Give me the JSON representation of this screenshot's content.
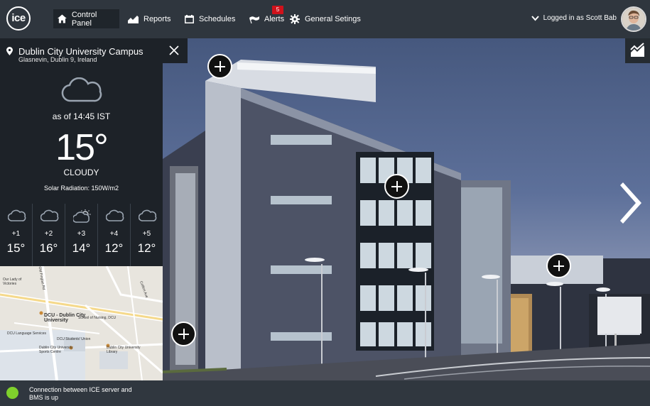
{
  "app": {
    "logo_text": "ice"
  },
  "nav": {
    "items": [
      {
        "label": "Control Panel",
        "icon": "home-icon"
      },
      {
        "label": "Reports",
        "icon": "chart-icon"
      },
      {
        "label": "Schedules",
        "icon": "calendar-icon"
      },
      {
        "label": "Alerts",
        "icon": "flag-icon"
      },
      {
        "label": "General Setings",
        "icon": "gear-icon"
      }
    ],
    "alerts_count": "5",
    "user_label": "Logged in as Scott Bab"
  },
  "location": {
    "title": "Dublin City University Campus",
    "subtitle": "Glasnevin, Dublin 9, Ireland"
  },
  "weather": {
    "as_of": "as of 14:45 IST",
    "temperature": "15°",
    "condition": "CLOUDY",
    "solar": "Solar Radiation: 150W/m2",
    "forecast": [
      {
        "day": "+1",
        "temp": "15°",
        "icon": "cloud-icon"
      },
      {
        "day": "+2",
        "temp": "16°",
        "icon": "cloud-icon"
      },
      {
        "day": "+3",
        "temp": "14°",
        "icon": "partly-sunny-icon"
      },
      {
        "day": "+4",
        "temp": "12°",
        "icon": "cloud-icon"
      },
      {
        "day": "+5",
        "temp": "12°",
        "icon": "cloud-icon"
      }
    ]
  },
  "map": {
    "labels": [
      "DCU - Dublin City University",
      "School of Nursing, DCU",
      "Dublin City University Library",
      "DCU Language Services",
      "DCU Students' Union",
      "Dublin City University Sports Centre",
      "Our Lady of Victories",
      "Old Finglas Rd",
      "Collins Ave"
    ]
  },
  "status": {
    "text": "Connection between ICE server and BMS is up",
    "color": "#7fd12c"
  }
}
